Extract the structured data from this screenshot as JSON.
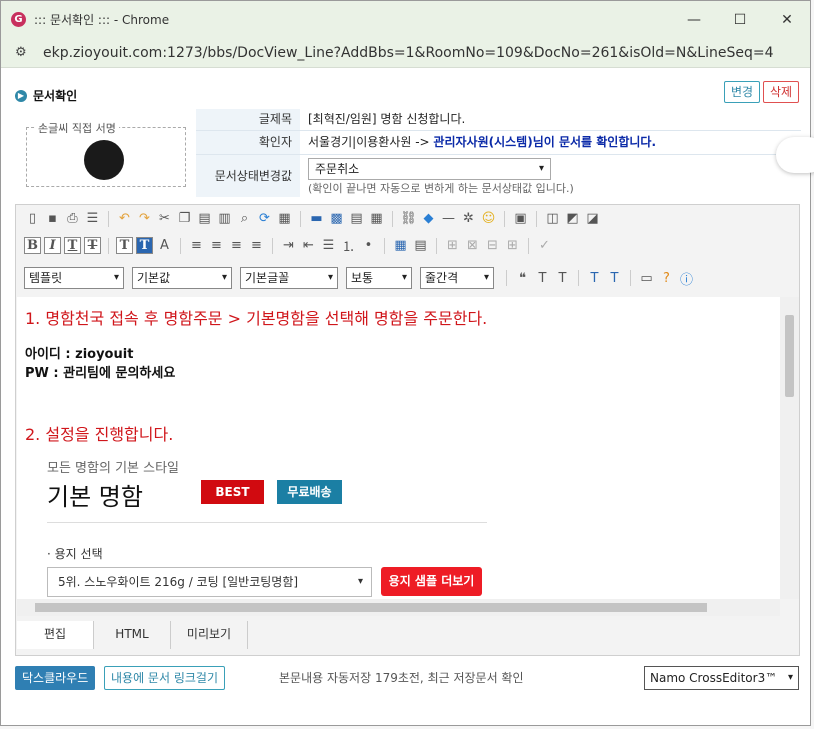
{
  "window": {
    "title": "::: 문서확인 ::: - Chrome",
    "url": "ekp.zioyouit.com:1273/bbs/DocView_Line?AddBbs=1&RoomNo=109&DocNo=261&isOld=N&LineSeq=4"
  },
  "header": {
    "title": "문서확인",
    "change_label": "변경",
    "delete_label": "삭제"
  },
  "sign": {
    "label": "손글씨 직접 서명"
  },
  "info": {
    "subject_key": "글제목",
    "subject_value": "[최혁진/임원] 명함 신청합니다.",
    "checker_key": "확인자",
    "checker_prefix": "서울경기|이용환사원 -> ",
    "checker_highlight": "관리자사원(시스템)님이 문서를 확인합니다.",
    "status_key": "문서상태변경값",
    "status_value": "주문취소",
    "status_hint": "(확인이 끝나면 자동으로 변하게 하는 문서상태값 입니다.)"
  },
  "toolbar": {
    "template": "템플릿",
    "default": "기본값",
    "font": "기본글꼴",
    "size": "보통",
    "line": "줄간격"
  },
  "content": {
    "step1": "1. 명함천국 접속 후 명함주문 > 기본명함을 선택해 명함을 주문한다.",
    "id_line": "아이디 : zioyouit",
    "pw_line": "PW : 관리팀에 문의하세요",
    "step2": "2. 설정을 진행합니다.",
    "card_sub": "모든 명함의 기본 스타일",
    "card_title": "기본 명함",
    "badge_best": "BEST",
    "badge_ship": "무료배송",
    "paper_label": "· 용지 선택",
    "paper_value": "5위. 스노우화이트 216g / 코팅 [일반코팅명함]",
    "sample_btn": "용지 샘플 더보기"
  },
  "tabs": [
    "편집",
    "HTML",
    "미리보기"
  ],
  "bottom": {
    "cloud": "닥스클라우드",
    "link": "내용에 문서 링크걸기",
    "autosave": "본문내용 자동저장 179초전, 최근 저장문서 확인",
    "editor": "Namo CrossEditor3™"
  }
}
